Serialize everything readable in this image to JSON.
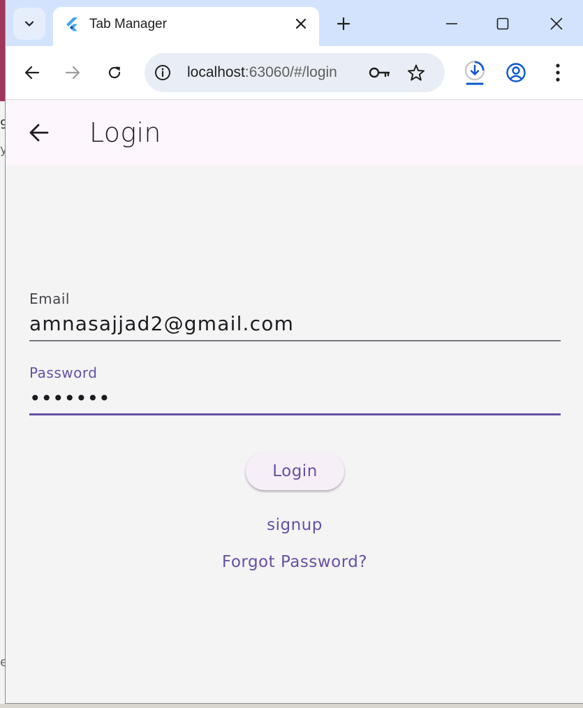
{
  "browser": {
    "tab_title": "Tab Manager",
    "url_host": "localhost",
    "url_path": ":63060/#/login"
  },
  "appbar": {
    "title": "Login"
  },
  "form": {
    "email_label": "Email",
    "email_value": "amnasajjad2@gmail.com",
    "password_label": "Password",
    "password_value": "•••••••"
  },
  "actions": {
    "login_label": "Login",
    "signup_label": "signup",
    "forgot_label": "Forgot Password?"
  },
  "colors": {
    "accent": "#6750a4",
    "tabstrip": "#d3e3fd",
    "appbar_bg": "#fdf7fd",
    "content_bg": "#f4f4f4"
  },
  "icons": [
    "tab-search-icon",
    "flutter-icon",
    "close-icon",
    "plus-icon",
    "minimize-icon",
    "maximize-icon",
    "window-close-icon",
    "back-arrow-icon",
    "forward-arrow-icon",
    "reload-icon",
    "info-icon",
    "key-icon",
    "star-icon",
    "download-icon",
    "profile-icon",
    "more-vert-icon"
  ]
}
